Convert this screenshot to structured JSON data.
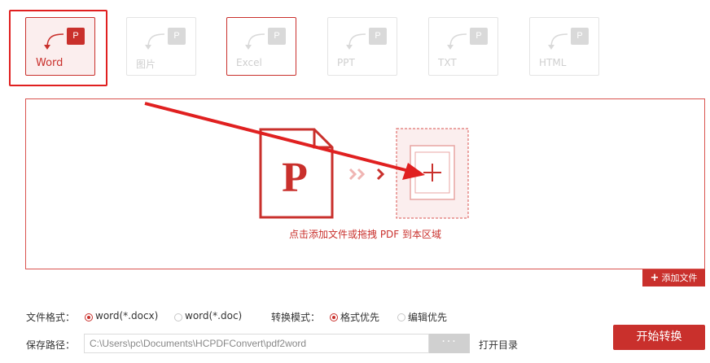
{
  "colors": {
    "accent": "#c9302c",
    "annotation": "#e02020",
    "disabled": "#d9d9d9"
  },
  "formats": [
    {
      "label": "Word",
      "badge": "P",
      "icon": "curve-arrow-icon"
    },
    {
      "label": "图片",
      "badge": "P",
      "icon": "curve-arrow-icon"
    },
    {
      "label": "Excel",
      "badge": "P",
      "icon": "curve-arrow-icon"
    },
    {
      "label": "PPT",
      "badge": "P",
      "icon": "curve-arrow-icon"
    },
    {
      "label": "TXT",
      "badge": "P",
      "icon": "curve-arrow-icon"
    },
    {
      "label": "HTML",
      "badge": "P",
      "icon": "curve-arrow-icon"
    }
  ],
  "dropzone": {
    "pdf_glyph": "P",
    "hint": "点击添加文件或拖拽 PDF 到本区域",
    "add_file_label": "添加文件"
  },
  "options": {
    "file_format_label": "文件格式：",
    "file_formats": [
      {
        "label": "word(*.docx)",
        "selected": true
      },
      {
        "label": "word(*.doc)",
        "selected": false
      }
    ],
    "convert_mode_label": "转换模式：",
    "convert_modes": [
      {
        "label": "格式优先",
        "selected": true
      },
      {
        "label": "编辑优先",
        "selected": false
      }
    ],
    "save_path_label": "保存路径：",
    "save_path": "C:\\Users\\pc\\Documents\\HCPDFConvert\\pdf2word",
    "browse_label": "···",
    "open_dir_label": "打开目录",
    "start_label": "开始转换"
  }
}
